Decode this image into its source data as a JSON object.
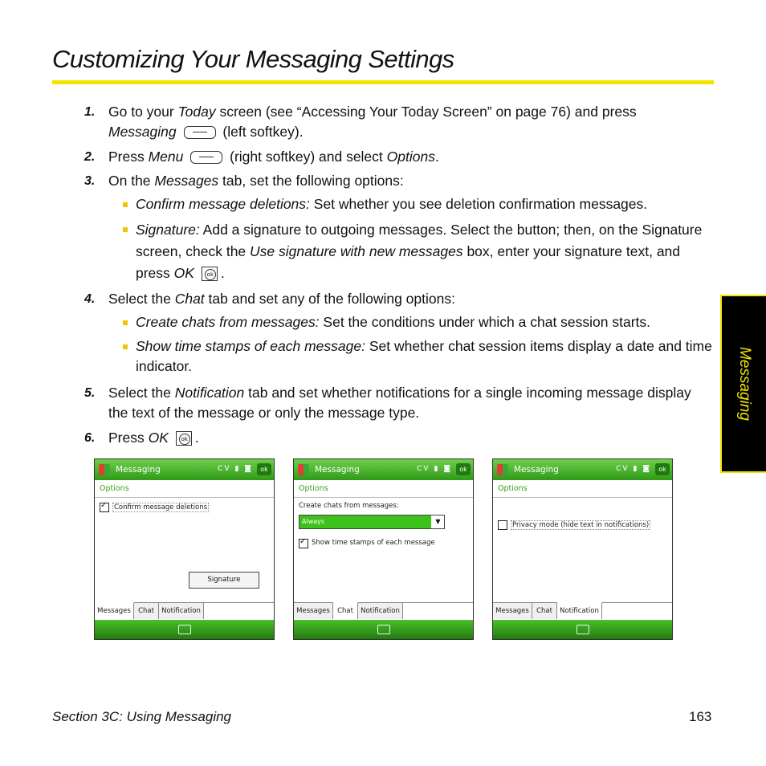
{
  "title": "Customizing Your Messaging Settings",
  "side_tab": "Messaging",
  "steps": [
    {
      "num": "1.",
      "a": "Go to your ",
      "b": "Today",
      "c": " screen (see “Accessing Your Today Screen” on page 76) and press",
      "d": "Messaging",
      "e": "(left softkey)."
    },
    {
      "num": "2.",
      "a": "Press ",
      "b": "Menu",
      "c": "(right softkey) and select ",
      "d": "Options",
      "e": "."
    },
    {
      "num": "3.",
      "a": "On the ",
      "b": "Messages",
      "c": " tab, set the following options:"
    },
    {
      "num": "4.",
      "a": "Select the ",
      "b": "Chat",
      "c": " tab and set any of the following options:"
    },
    {
      "num": "5.",
      "a": "Select the ",
      "b": "Notification",
      "c": " tab and set whether notifications for a single incoming message display the text of the message or only the message type."
    },
    {
      "num": "6.",
      "a": "Press ",
      "b": "OK",
      "c": "."
    }
  ],
  "bullets": [
    {
      "label": "Confirm message deletions:",
      "text": " Set whether you see deletion confirmation messages."
    },
    {
      "label": "Signature:",
      "text": " Add a signature to outgoing messages. Select the button; then, on the Signature screen, check the ",
      "label2": "Use signature with new messages",
      "text2": " box, enter your signature text, and press ",
      "label3": "OK",
      "text3": "."
    },
    {
      "label": "Create chats from messages:",
      "text": " Set the conditions under which a chat session starts."
    },
    {
      "label": "Show time stamps of each message:",
      "text": " Set whether chat session items display a date and time indicator."
    }
  ],
  "screens": {
    "app_title": "Messaging",
    "status_icons": "CV ▮ ◙",
    "ok": "ok",
    "options_heading": "Options",
    "tabs": [
      "Messages",
      "Chat",
      "Notification"
    ],
    "s1": {
      "checkbox": "Confirm message deletions",
      "button": "Signature"
    },
    "s2": {
      "combo_label": "Create chats from messages:",
      "combo_value": "Always",
      "checkbox": "Show time stamps of each message"
    },
    "s3": {
      "checkbox": "Privacy mode (hide text in notifications)"
    }
  },
  "footer": {
    "section": "Section 3C: Using Messaging",
    "page": "163"
  }
}
